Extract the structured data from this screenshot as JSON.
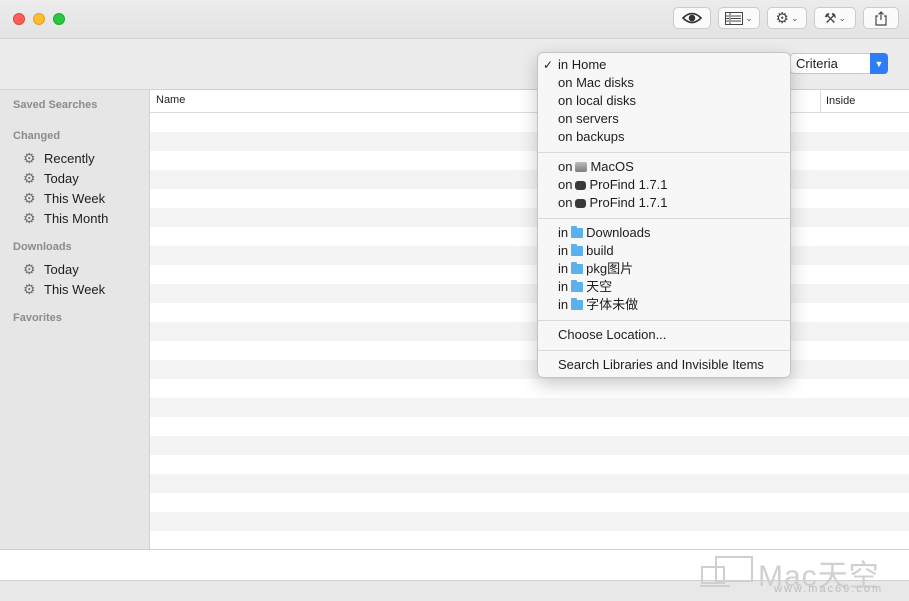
{
  "toolbar": {
    "buttons": [
      {
        "name": "quick-look",
        "icon": "eye-icon"
      },
      {
        "name": "view-options",
        "icon": "list-view-icon"
      },
      {
        "name": "action-menu",
        "icon": "gear-icon"
      },
      {
        "name": "tools-menu",
        "icon": "tools-icon"
      },
      {
        "name": "share",
        "icon": "share-icon"
      }
    ]
  },
  "criteria": {
    "label": "Criteria"
  },
  "sidebar": {
    "saved_searches": "Saved Searches",
    "changed": {
      "heading": "Changed",
      "items": [
        "Recently",
        "Today",
        "This Week",
        "This Month"
      ]
    },
    "downloads": {
      "heading": "Downloads",
      "items": [
        "Today",
        "This Week"
      ]
    },
    "favorites": "Favorites"
  },
  "list": {
    "columns": {
      "name": "Name",
      "inside": "Inside"
    }
  },
  "menu": {
    "scopes": [
      {
        "label": "in Home",
        "checked": true
      },
      {
        "label": "on Mac disks",
        "checked": false
      },
      {
        "label": "on local disks",
        "checked": false
      },
      {
        "label": "on servers",
        "checked": false
      },
      {
        "label": "on backups",
        "checked": false
      }
    ],
    "volumes": [
      {
        "prefix": "on",
        "name": "MacOS",
        "icon": "internal-disk-icon"
      },
      {
        "prefix": "on",
        "name": "ProFind 1.7.1",
        "icon": "external-disk-icon"
      },
      {
        "prefix": "on",
        "name": "ProFind 1.7.1",
        "icon": "external-disk-icon"
      }
    ],
    "folders": [
      {
        "prefix": "in",
        "name": "Downloads"
      },
      {
        "prefix": "in",
        "name": "build"
      },
      {
        "prefix": "in",
        "name": "pkg图片"
      },
      {
        "prefix": "in",
        "name": "天空"
      },
      {
        "prefix": "in",
        "name": "字体未做"
      }
    ],
    "choose_location": "Choose Location...",
    "search_libraries": "Search Libraries and Invisible Items"
  },
  "watermark": {
    "brand": "Mac天空",
    "url": "www.mac69.com"
  },
  "colors": {
    "accent": "#2f7df6",
    "folder": "#5bb1ee"
  }
}
